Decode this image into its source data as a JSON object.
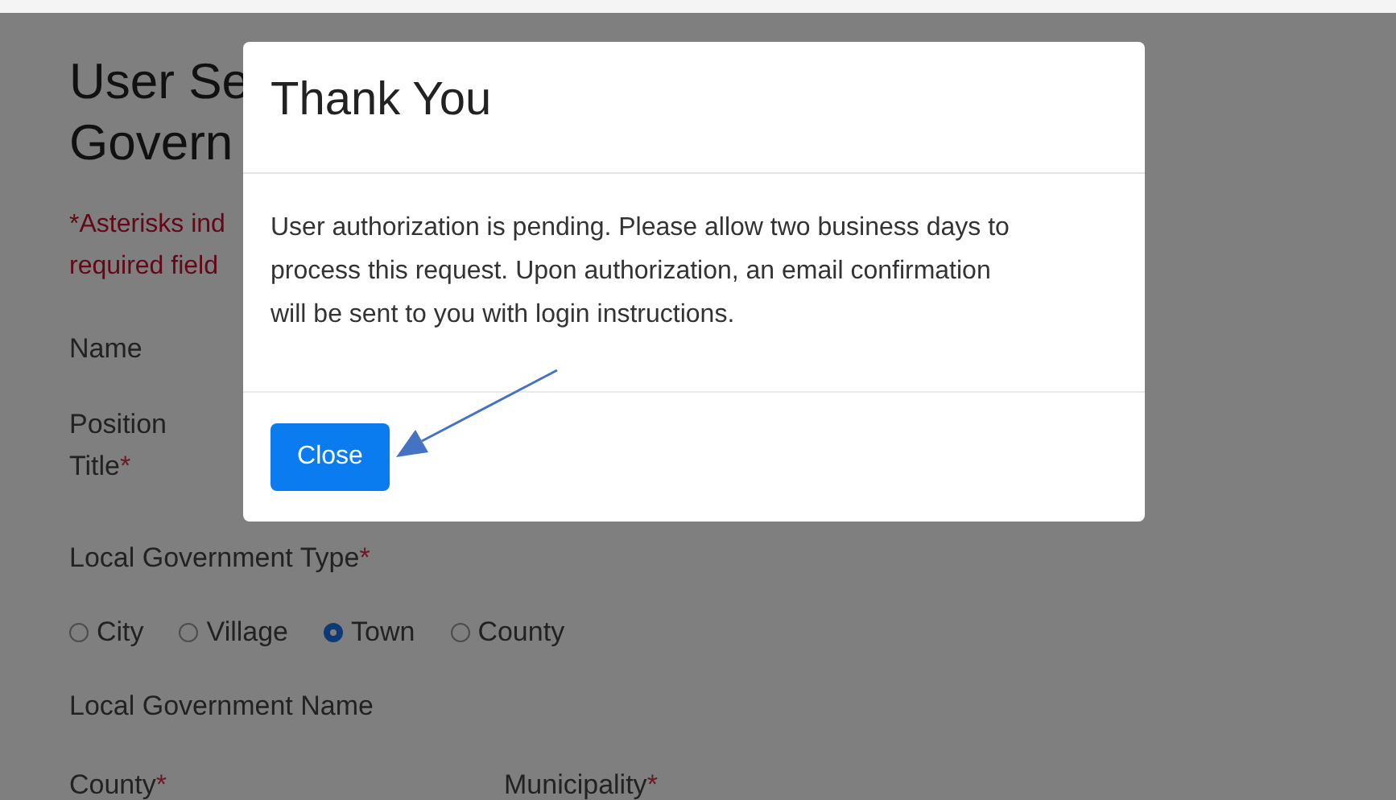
{
  "page": {
    "heading_lines": [
      "User Se",
      "Govern"
    ],
    "note_lines": [
      "*Asterisks ind",
      "required field"
    ],
    "rows": [
      {
        "kind": "label",
        "lines": [
          {
            "text": "Name"
          }
        ]
      },
      {
        "kind": "label",
        "lines": [
          {
            "text": "Position"
          },
          {
            "text": "Title",
            "mark": "*"
          }
        ]
      },
      {
        "kind": "label",
        "lines": [
          {
            "text": "Local Government Type",
            "mark": "*"
          }
        ]
      },
      {
        "kind": "radios",
        "options": [
          {
            "label": "City",
            "selected": false
          },
          {
            "label": "Village",
            "selected": false
          },
          {
            "label": "Town",
            "selected": true
          },
          {
            "label": "County",
            "selected": false
          }
        ]
      },
      {
        "kind": "label",
        "lines": [
          {
            "text": "Local Government Name"
          }
        ]
      },
      {
        "kind": "pair",
        "items": [
          {
            "text": "County",
            "mark": "*"
          },
          {
            "text": "Municipality",
            "mark": "*"
          }
        ]
      }
    ]
  },
  "dialog": {
    "title": "Thank You",
    "message": "User authorization is pending. Please allow two business days to process this request. Upon authorization, an email confirmation will be sent to you with login instructions.",
    "button": "Close"
  }
}
